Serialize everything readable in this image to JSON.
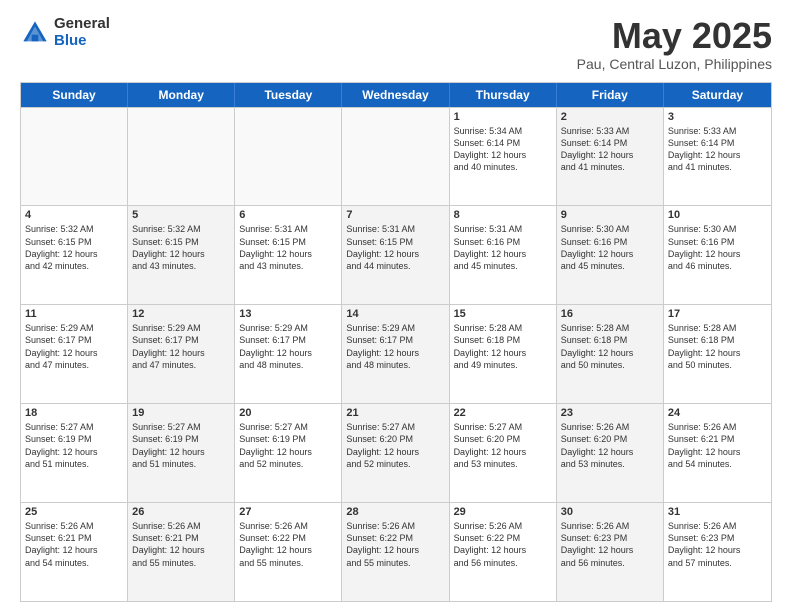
{
  "logo": {
    "general": "General",
    "blue": "Blue"
  },
  "title": "May 2025",
  "subtitle": "Pau, Central Luzon, Philippines",
  "days": [
    "Sunday",
    "Monday",
    "Tuesday",
    "Wednesday",
    "Thursday",
    "Friday",
    "Saturday"
  ],
  "weeks": [
    [
      {
        "day": "",
        "sunrise": "",
        "sunset": "",
        "daylight": "",
        "shaded": false,
        "empty": true
      },
      {
        "day": "",
        "sunrise": "",
        "sunset": "",
        "daylight": "",
        "shaded": false,
        "empty": true
      },
      {
        "day": "",
        "sunrise": "",
        "sunset": "",
        "daylight": "",
        "shaded": false,
        "empty": true
      },
      {
        "day": "",
        "sunrise": "",
        "sunset": "",
        "daylight": "",
        "shaded": false,
        "empty": true
      },
      {
        "day": "1",
        "sunrise": "Sunrise: 5:34 AM",
        "sunset": "Sunset: 6:14 PM",
        "daylight": "Daylight: 12 hours",
        "extra": "and 40 minutes.",
        "shaded": false,
        "empty": false
      },
      {
        "day": "2",
        "sunrise": "Sunrise: 5:33 AM",
        "sunset": "Sunset: 6:14 PM",
        "daylight": "Daylight: 12 hours",
        "extra": "and 41 minutes.",
        "shaded": true,
        "empty": false
      },
      {
        "day": "3",
        "sunrise": "Sunrise: 5:33 AM",
        "sunset": "Sunset: 6:14 PM",
        "daylight": "Daylight: 12 hours",
        "extra": "and 41 minutes.",
        "shaded": false,
        "empty": false
      }
    ],
    [
      {
        "day": "4",
        "sunrise": "Sunrise: 5:32 AM",
        "sunset": "Sunset: 6:15 PM",
        "daylight": "Daylight: 12 hours",
        "extra": "and 42 minutes.",
        "shaded": false,
        "empty": false
      },
      {
        "day": "5",
        "sunrise": "Sunrise: 5:32 AM",
        "sunset": "Sunset: 6:15 PM",
        "daylight": "Daylight: 12 hours",
        "extra": "and 43 minutes.",
        "shaded": true,
        "empty": false
      },
      {
        "day": "6",
        "sunrise": "Sunrise: 5:31 AM",
        "sunset": "Sunset: 6:15 PM",
        "daylight": "Daylight: 12 hours",
        "extra": "and 43 minutes.",
        "shaded": false,
        "empty": false
      },
      {
        "day": "7",
        "sunrise": "Sunrise: 5:31 AM",
        "sunset": "Sunset: 6:15 PM",
        "daylight": "Daylight: 12 hours",
        "extra": "and 44 minutes.",
        "shaded": true,
        "empty": false
      },
      {
        "day": "8",
        "sunrise": "Sunrise: 5:31 AM",
        "sunset": "Sunset: 6:16 PM",
        "daylight": "Daylight: 12 hours",
        "extra": "and 45 minutes.",
        "shaded": false,
        "empty": false
      },
      {
        "day": "9",
        "sunrise": "Sunrise: 5:30 AM",
        "sunset": "Sunset: 6:16 PM",
        "daylight": "Daylight: 12 hours",
        "extra": "and 45 minutes.",
        "shaded": true,
        "empty": false
      },
      {
        "day": "10",
        "sunrise": "Sunrise: 5:30 AM",
        "sunset": "Sunset: 6:16 PM",
        "daylight": "Daylight: 12 hours",
        "extra": "and 46 minutes.",
        "shaded": false,
        "empty": false
      }
    ],
    [
      {
        "day": "11",
        "sunrise": "Sunrise: 5:29 AM",
        "sunset": "Sunset: 6:17 PM",
        "daylight": "Daylight: 12 hours",
        "extra": "and 47 minutes.",
        "shaded": false,
        "empty": false
      },
      {
        "day": "12",
        "sunrise": "Sunrise: 5:29 AM",
        "sunset": "Sunset: 6:17 PM",
        "daylight": "Daylight: 12 hours",
        "extra": "and 47 minutes.",
        "shaded": true,
        "empty": false
      },
      {
        "day": "13",
        "sunrise": "Sunrise: 5:29 AM",
        "sunset": "Sunset: 6:17 PM",
        "daylight": "Daylight: 12 hours",
        "extra": "and 48 minutes.",
        "shaded": false,
        "empty": false
      },
      {
        "day": "14",
        "sunrise": "Sunrise: 5:29 AM",
        "sunset": "Sunset: 6:17 PM",
        "daylight": "Daylight: 12 hours",
        "extra": "and 48 minutes.",
        "shaded": true,
        "empty": false
      },
      {
        "day": "15",
        "sunrise": "Sunrise: 5:28 AM",
        "sunset": "Sunset: 6:18 PM",
        "daylight": "Daylight: 12 hours",
        "extra": "and 49 minutes.",
        "shaded": false,
        "empty": false
      },
      {
        "day": "16",
        "sunrise": "Sunrise: 5:28 AM",
        "sunset": "Sunset: 6:18 PM",
        "daylight": "Daylight: 12 hours",
        "extra": "and 50 minutes.",
        "shaded": true,
        "empty": false
      },
      {
        "day": "17",
        "sunrise": "Sunrise: 5:28 AM",
        "sunset": "Sunset: 6:18 PM",
        "daylight": "Daylight: 12 hours",
        "extra": "and 50 minutes.",
        "shaded": false,
        "empty": false
      }
    ],
    [
      {
        "day": "18",
        "sunrise": "Sunrise: 5:27 AM",
        "sunset": "Sunset: 6:19 PM",
        "daylight": "Daylight: 12 hours",
        "extra": "and 51 minutes.",
        "shaded": false,
        "empty": false
      },
      {
        "day": "19",
        "sunrise": "Sunrise: 5:27 AM",
        "sunset": "Sunset: 6:19 PM",
        "daylight": "Daylight: 12 hours",
        "extra": "and 51 minutes.",
        "shaded": true,
        "empty": false
      },
      {
        "day": "20",
        "sunrise": "Sunrise: 5:27 AM",
        "sunset": "Sunset: 6:19 PM",
        "daylight": "Daylight: 12 hours",
        "extra": "and 52 minutes.",
        "shaded": false,
        "empty": false
      },
      {
        "day": "21",
        "sunrise": "Sunrise: 5:27 AM",
        "sunset": "Sunset: 6:20 PM",
        "daylight": "Daylight: 12 hours",
        "extra": "and 52 minutes.",
        "shaded": true,
        "empty": false
      },
      {
        "day": "22",
        "sunrise": "Sunrise: 5:27 AM",
        "sunset": "Sunset: 6:20 PM",
        "daylight": "Daylight: 12 hours",
        "extra": "and 53 minutes.",
        "shaded": false,
        "empty": false
      },
      {
        "day": "23",
        "sunrise": "Sunrise: 5:26 AM",
        "sunset": "Sunset: 6:20 PM",
        "daylight": "Daylight: 12 hours",
        "extra": "and 53 minutes.",
        "shaded": true,
        "empty": false
      },
      {
        "day": "24",
        "sunrise": "Sunrise: 5:26 AM",
        "sunset": "Sunset: 6:21 PM",
        "daylight": "Daylight: 12 hours",
        "extra": "and 54 minutes.",
        "shaded": false,
        "empty": false
      }
    ],
    [
      {
        "day": "25",
        "sunrise": "Sunrise: 5:26 AM",
        "sunset": "Sunset: 6:21 PM",
        "daylight": "Daylight: 12 hours",
        "extra": "and 54 minutes.",
        "shaded": false,
        "empty": false
      },
      {
        "day": "26",
        "sunrise": "Sunrise: 5:26 AM",
        "sunset": "Sunset: 6:21 PM",
        "daylight": "Daylight: 12 hours",
        "extra": "and 55 minutes.",
        "shaded": true,
        "empty": false
      },
      {
        "day": "27",
        "sunrise": "Sunrise: 5:26 AM",
        "sunset": "Sunset: 6:22 PM",
        "daylight": "Daylight: 12 hours",
        "extra": "and 55 minutes.",
        "shaded": false,
        "empty": false
      },
      {
        "day": "28",
        "sunrise": "Sunrise: 5:26 AM",
        "sunset": "Sunset: 6:22 PM",
        "daylight": "Daylight: 12 hours",
        "extra": "and 55 minutes.",
        "shaded": true,
        "empty": false
      },
      {
        "day": "29",
        "sunrise": "Sunrise: 5:26 AM",
        "sunset": "Sunset: 6:22 PM",
        "daylight": "Daylight: 12 hours",
        "extra": "and 56 minutes.",
        "shaded": false,
        "empty": false
      },
      {
        "day": "30",
        "sunrise": "Sunrise: 5:26 AM",
        "sunset": "Sunset: 6:23 PM",
        "daylight": "Daylight: 12 hours",
        "extra": "and 56 minutes.",
        "shaded": true,
        "empty": false
      },
      {
        "day": "31",
        "sunrise": "Sunrise: 5:26 AM",
        "sunset": "Sunset: 6:23 PM",
        "daylight": "Daylight: 12 hours",
        "extra": "and 57 minutes.",
        "shaded": false,
        "empty": false
      }
    ]
  ]
}
